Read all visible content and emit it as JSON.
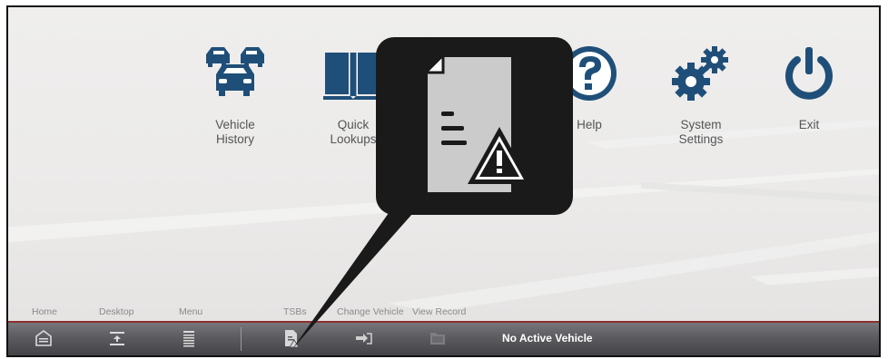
{
  "apps": [
    {
      "id": "vehicle-history",
      "label": "Vehicle\nHistory",
      "icon": "cars-icon"
    },
    {
      "id": "quick-lookups",
      "label": "Quick\nLookups",
      "icon": "book-icon"
    },
    {
      "id": "hidden",
      "label": "",
      "icon": "folder-icon"
    },
    {
      "id": "help",
      "label": "Help",
      "icon": "help-icon"
    },
    {
      "id": "system-settings",
      "label": "System\nSettings",
      "icon": "gears-icon"
    },
    {
      "id": "exit",
      "label": "Exit",
      "icon": "power-icon"
    }
  ],
  "toolbar": {
    "home_label": "Home",
    "desktop_label": "Desktop",
    "menu_label": "Menu",
    "tsbs_label": "TSBs",
    "change_vehicle_label": "Change Vehicle",
    "view_record_label": "View Record",
    "status_text": "No Active Vehicle"
  },
  "callout": {
    "icon": "tsb-document-warning-icon"
  },
  "colors": {
    "icon_blue": "#1f4f79",
    "bar_dark": "#4a494e",
    "accent_red": "#8c2f2f",
    "callout_black": "#1a1a1a",
    "doc_gray": "#c8c8c8"
  }
}
